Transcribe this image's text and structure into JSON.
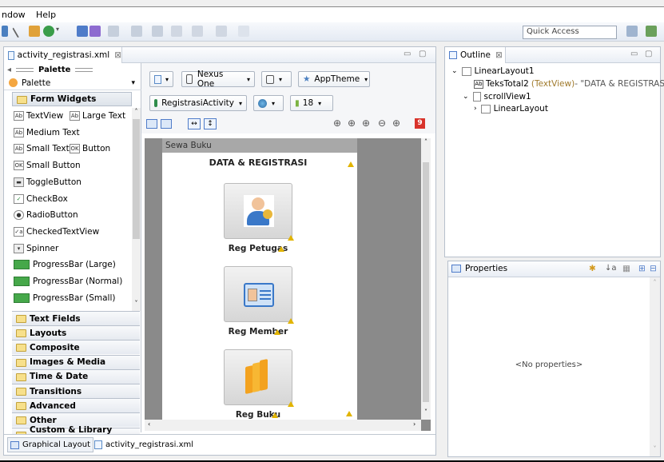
{
  "menu": {
    "window": "ndow",
    "help": "Help"
  },
  "toolbar": {
    "quick_access": "Quick Access"
  },
  "editor": {
    "tab_title": "activity_registrasi.xml",
    "tab_close": "⊠"
  },
  "palette": {
    "header": "Palette",
    "dropdown_label": "Palette",
    "section": "Form Widgets",
    "widgets": [
      {
        "left_icon": "Ab",
        "left": "TextView",
        "right_icon": "Ab",
        "right": "Large Text"
      },
      {
        "left_icon": "Ab",
        "left": "Medium Text"
      },
      {
        "left_icon": "Ab",
        "left": "Small Text",
        "right_icon": "OK",
        "right": "Button"
      },
      {
        "left_icon": "OK",
        "left": "Small Button"
      },
      {
        "left_icon": "toggle",
        "left": "ToggleButton"
      },
      {
        "left_icon": "check",
        "left": "CheckBox"
      },
      {
        "left_icon": "radio",
        "left": "RadioButton"
      },
      {
        "left_icon": "checked",
        "left": "CheckedTextView"
      },
      {
        "left_icon": "spinner",
        "left": "Spinner"
      },
      {
        "left_icon": "progress",
        "left": "ProgressBar (Large)"
      },
      {
        "left_icon": "progress",
        "left": "ProgressBar (Normal)"
      },
      {
        "left_icon": "progress",
        "left": "ProgressBar (Small)"
      }
    ],
    "categories": [
      "Text Fields",
      "Layouts",
      "Composite",
      "Images & Media",
      "Time & Date",
      "Transitions",
      "Advanced",
      "Other",
      "Custom & Library Views"
    ]
  },
  "config": {
    "device": "Nexus One",
    "theme": "AppTheme",
    "activity": "RegistrasiActivity",
    "api": "18"
  },
  "preview": {
    "app_title": "Sewa Buku",
    "heading": "DATA & REGISTRASI",
    "items": [
      {
        "label": "Reg Petugas",
        "icon": "officer-icon"
      },
      {
        "label": "Reg Member",
        "icon": "id-card-icon"
      },
      {
        "label": "Reg Buku",
        "icon": "books-icon"
      }
    ],
    "error_badge": "9"
  },
  "bottom_tabs": {
    "graphical": "Graphical Layout",
    "xml": "activity_registrasi.xml"
  },
  "outline": {
    "title": "Outline",
    "nodes": [
      {
        "label": "LinearLayout1",
        "extra": ""
      },
      {
        "label": "TeksTotal2",
        "type": "(TextView)",
        "extra": " - \"DATA & REGISTRASI\""
      },
      {
        "label": "scrollView1",
        "extra": ""
      },
      {
        "label": "LinearLayout",
        "extra": ""
      }
    ]
  },
  "properties": {
    "title": "Properties",
    "empty": "<No properties>"
  },
  "colors": {
    "accent": "#3a6ea5",
    "warning": "#e2b400",
    "error": "#d8332b"
  }
}
